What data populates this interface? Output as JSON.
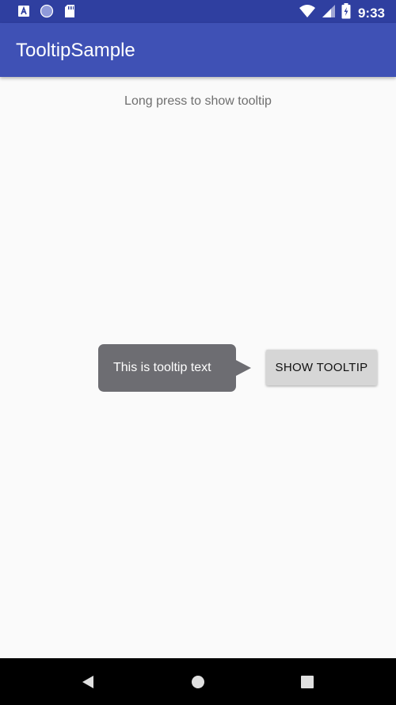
{
  "status_bar": {
    "time": "9:33",
    "notification_icons": [
      "a-box-icon",
      "circle-icon",
      "sd-card-icon"
    ],
    "system_icons": [
      "wifi-icon",
      "signal-icon",
      "battery-charging-icon"
    ]
  },
  "app_bar": {
    "title": "TooltipSample"
  },
  "main": {
    "hint": "Long press to show tooltip",
    "tooltip_text": "This is tooltip text",
    "button_label": "SHOW TOOLTIP"
  },
  "nav_bar": {
    "buttons": [
      "back-icon",
      "home-icon",
      "recents-icon"
    ]
  },
  "colors": {
    "status_bar": "#2f3fa0",
    "app_bar": "#3f51b5",
    "background": "#fafafa",
    "tooltip": "#6d6d72",
    "button": "#d6d6d6"
  }
}
